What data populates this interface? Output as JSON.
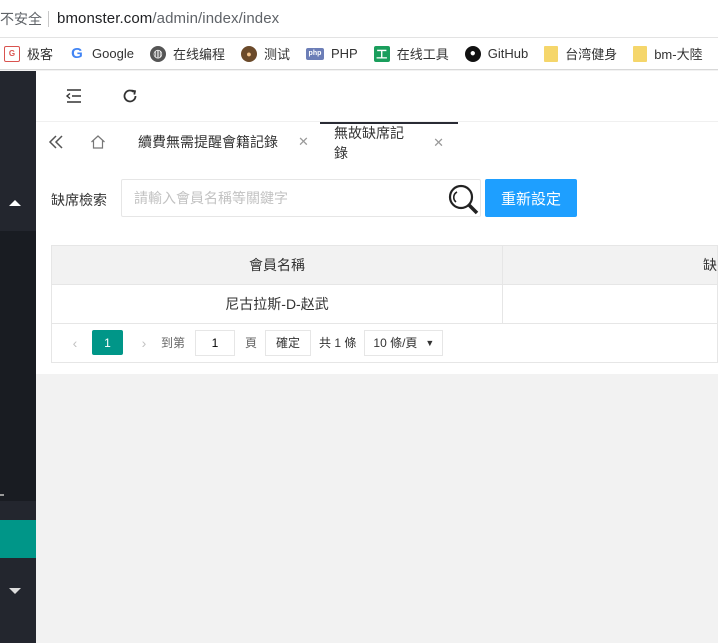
{
  "browser": {
    "security_label": "不安全",
    "url_host": "bmonster.com",
    "url_path": "/admin/index/index",
    "bookmarks": [
      {
        "label": "极客",
        "icon": "jike-icon"
      },
      {
        "label": "Google",
        "icon": "google-icon"
      },
      {
        "label": "在线编程",
        "icon": "globe-icon"
      },
      {
        "label": "测试",
        "icon": "dog-icon"
      },
      {
        "label": "PHP",
        "icon": "php-icon"
      },
      {
        "label": "在线工具",
        "icon": "tool-icon"
      },
      {
        "label": "GitHub",
        "icon": "github-icon"
      },
      {
        "label": "台湾健身",
        "icon": "folder-icon"
      },
      {
        "label": "bm-大陸",
        "icon": "folder-icon"
      }
    ]
  },
  "tabs": [
    {
      "label": "續費無需提醒會籍記錄",
      "active": false
    },
    {
      "label": "無故缺席記錄",
      "active": true
    }
  ],
  "search": {
    "label": "缺席檢索",
    "placeholder": "請輸入會員名稱等關鍵字",
    "reset_label": "重新設定"
  },
  "table": {
    "headers": [
      "會員名稱",
      "缺"
    ],
    "rows": [
      [
        "尼古拉斯-D-赵武",
        ""
      ]
    ]
  },
  "pager": {
    "current_page": "1",
    "goto_label": "到第",
    "goto_value": "1",
    "page_unit": "頁",
    "confirm_label": "確定",
    "total_label": "共 1 條",
    "page_size": "10 條/頁"
  },
  "colors": {
    "accent": "#009688",
    "primary_button": "#1e9fff",
    "sidebar": "#23262e"
  }
}
